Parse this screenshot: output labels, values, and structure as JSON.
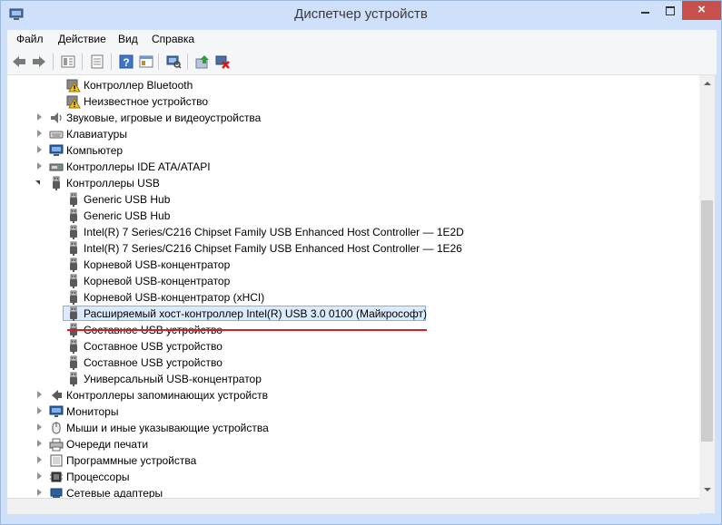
{
  "window": {
    "title": "Диспетчер устройств",
    "close_label": "×"
  },
  "menu": {
    "items": [
      "Файл",
      "Действие",
      "Вид",
      "Справка"
    ]
  },
  "colors": {
    "accent": "#c7504c",
    "selection_fill": "#dcebfc",
    "selection_border": "#7eb4ea",
    "annotation": "#d0202a"
  },
  "tree": {
    "rows": [
      {
        "label": "Контроллер Bluetooth",
        "icon": "warning-device-icon",
        "level": 1,
        "expander": "none"
      },
      {
        "label": "Неизвестное устройство",
        "icon": "warning-device-icon",
        "level": 1,
        "expander": "none"
      },
      {
        "label": "Звуковые, игровые и видеоустройства",
        "icon": "speaker-icon",
        "level": 0,
        "expander": "collapsed"
      },
      {
        "label": "Клавиатуры",
        "icon": "keyboard-icon",
        "level": 0,
        "expander": "collapsed"
      },
      {
        "label": "Компьютер",
        "icon": "computer-icon",
        "level": 0,
        "expander": "collapsed"
      },
      {
        "label": "Контроллеры IDE ATA/ATAPI",
        "icon": "ide-controller-icon",
        "level": 0,
        "expander": "collapsed"
      },
      {
        "label": "Контроллеры USB",
        "icon": "usb-plug-icon",
        "level": 0,
        "expander": "expanded"
      },
      {
        "label": "Generic USB Hub",
        "icon": "usb-plug-icon",
        "level": 1,
        "expander": "none"
      },
      {
        "label": "Generic USB Hub",
        "icon": "usb-plug-icon",
        "level": 1,
        "expander": "none"
      },
      {
        "label": "Intel(R) 7 Series/C216 Chipset Family USB Enhanced Host Controller — 1E2D",
        "icon": "usb-plug-icon",
        "level": 1,
        "expander": "none"
      },
      {
        "label": "Intel(R) 7 Series/C216 Chipset Family USB Enhanced Host Controller — 1E26",
        "icon": "usb-plug-icon",
        "level": 1,
        "expander": "none"
      },
      {
        "label": "Корневой USB-концентратор",
        "icon": "usb-plug-icon",
        "level": 1,
        "expander": "none"
      },
      {
        "label": "Корневой USB-концентратор",
        "icon": "usb-plug-icon",
        "level": 1,
        "expander": "none"
      },
      {
        "label": "Корневой USB-концентратор (xHCI)",
        "icon": "usb-plug-icon",
        "level": 1,
        "expander": "none"
      },
      {
        "label": "Расширяемый хост-контроллер Intel(R) USB 3.0 0100 (Майкрософт)",
        "icon": "usb-plug-icon",
        "level": 1,
        "expander": "none",
        "selected": true
      },
      {
        "label": "Составное USB устройство",
        "icon": "usb-plug-icon",
        "level": 1,
        "expander": "none"
      },
      {
        "label": "Составное USB устройство",
        "icon": "usb-plug-icon",
        "level": 1,
        "expander": "none"
      },
      {
        "label": "Составное USB устройство",
        "icon": "usb-plug-icon",
        "level": 1,
        "expander": "none"
      },
      {
        "label": "Универсальный USB-концентратор",
        "icon": "usb-plug-icon",
        "level": 1,
        "expander": "none"
      },
      {
        "label": "Контроллеры запоминающих устройств",
        "icon": "storage-controller-icon",
        "level": 0,
        "expander": "collapsed"
      },
      {
        "label": "Мониторы",
        "icon": "monitor-icon",
        "level": 0,
        "expander": "collapsed"
      },
      {
        "label": "Мыши и иные указывающие устройства",
        "icon": "mouse-icon",
        "level": 0,
        "expander": "collapsed"
      },
      {
        "label": "Очереди печати",
        "icon": "printer-icon",
        "level": 0,
        "expander": "collapsed"
      },
      {
        "label": "Программные устройства",
        "icon": "software-device-icon",
        "level": 0,
        "expander": "collapsed"
      },
      {
        "label": "Процессоры",
        "icon": "processor-icon",
        "level": 0,
        "expander": "collapsed"
      },
      {
        "label": "Сетевые адаптеры",
        "icon": "network-adapter-icon",
        "level": 0,
        "expander": "collapsed"
      }
    ]
  }
}
